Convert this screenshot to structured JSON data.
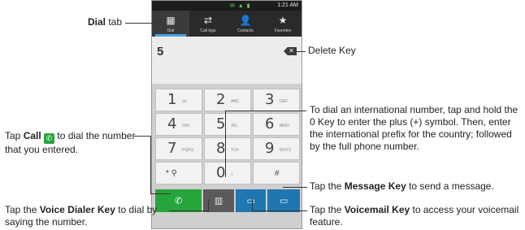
{
  "status_bar": {
    "time": "1:21 AM",
    "icons": "✉ ▲ ▮"
  },
  "tabs": [
    {
      "label": "Dial",
      "icon": "grid-icon",
      "glyph": "▦",
      "active": true
    },
    {
      "label": "Call logs",
      "icon": "call-logs-icon",
      "glyph": "⇄",
      "active": false
    },
    {
      "label": "Contacts",
      "icon": "contacts-icon",
      "glyph": "👤",
      "active": false
    },
    {
      "label": "Favorites",
      "icon": "star-icon",
      "glyph": "★",
      "active": false
    }
  ],
  "entry": {
    "number": "5",
    "delete_glyph": "✕"
  },
  "keys": [
    {
      "digit": "1",
      "letters": "oo"
    },
    {
      "digit": "2",
      "letters": "ABC"
    },
    {
      "digit": "3",
      "letters": "DEF"
    },
    {
      "digit": "4",
      "letters": "GHI"
    },
    {
      "digit": "5",
      "letters": "JKL"
    },
    {
      "digit": "6",
      "letters": "MNO"
    },
    {
      "digit": "7",
      "letters": "PQRS"
    },
    {
      "digit": "8",
      "letters": "TUV"
    },
    {
      "digit": "9",
      "letters": "WXYZ"
    },
    {
      "digit": "* ⚲",
      "letters": ""
    },
    {
      "digit": "0",
      "letters": "+"
    },
    {
      "digit": "#",
      "letters": ""
    }
  ],
  "bottom_keys": {
    "call_glyph": "✆",
    "voice_dialer_glyph": "▥",
    "voicemail_glyph": "▭",
    "message_glyph": "▭"
  },
  "annotations": {
    "dial_tab": {
      "bold": "Dial",
      "rest": " tab"
    },
    "delete_key": "Delete Key",
    "international": "To dial an international number, tap and hold the 0 Key to enter the plus (+) symbol. Then, enter the international prefix for the country; followed by the full phone number.",
    "call_pre": "Tap ",
    "call_bold": "Call",
    "call_post": " to dial the number that you entered.",
    "message_pre": "Tap the ",
    "message_bold": "Message Key",
    "message_post": " to send a message.",
    "voice_dialer_pre": "Tap the ",
    "voice_dialer_bold": "Voice Dialer Key",
    "voice_dialer_post": " to dial by saying the number.",
    "voicemail_pre": "Tap the ",
    "voicemail_bold": "Voicemail Key",
    "voicemail_post": " to access your voicemail feature."
  }
}
